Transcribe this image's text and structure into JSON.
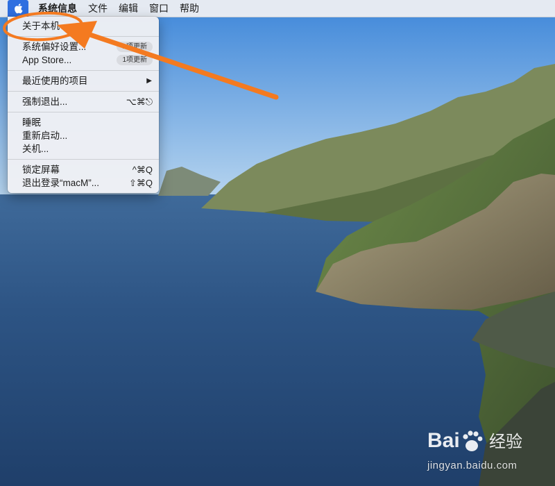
{
  "menubar": {
    "app_name": "系统信息",
    "items": [
      {
        "label": "文件"
      },
      {
        "label": "编辑"
      },
      {
        "label": "窗口"
      },
      {
        "label": "帮助"
      }
    ]
  },
  "apple_menu": {
    "items": [
      {
        "label": "关于本机"
      },
      {
        "label": "系统偏好设置...",
        "badge": "1项更新"
      },
      {
        "label": "App Store...",
        "badge": "1项更新"
      },
      {
        "label": "最近使用的项目",
        "submenu": "▶"
      },
      {
        "label": "强制退出...",
        "shortcut": "⌥⌘⎋"
      },
      {
        "label": "睡眠"
      },
      {
        "label": "重新启动..."
      },
      {
        "label": "关机..."
      },
      {
        "label": "锁定屏幕",
        "shortcut": "^⌘Q"
      },
      {
        "label": "退出登录“macM”...",
        "shortcut": "⇧⌘Q"
      }
    ]
  },
  "watermark": {
    "brand": "Bai  经验",
    "url": "jingyan.baidu.com"
  },
  "colors": {
    "annotation": "#f47a20",
    "apple_highlight": "#2f6fe0",
    "sea": "#2a4f7e"
  },
  "icons": {
    "apple": "apple-icon",
    "paw": "baidu-paw-icon"
  }
}
